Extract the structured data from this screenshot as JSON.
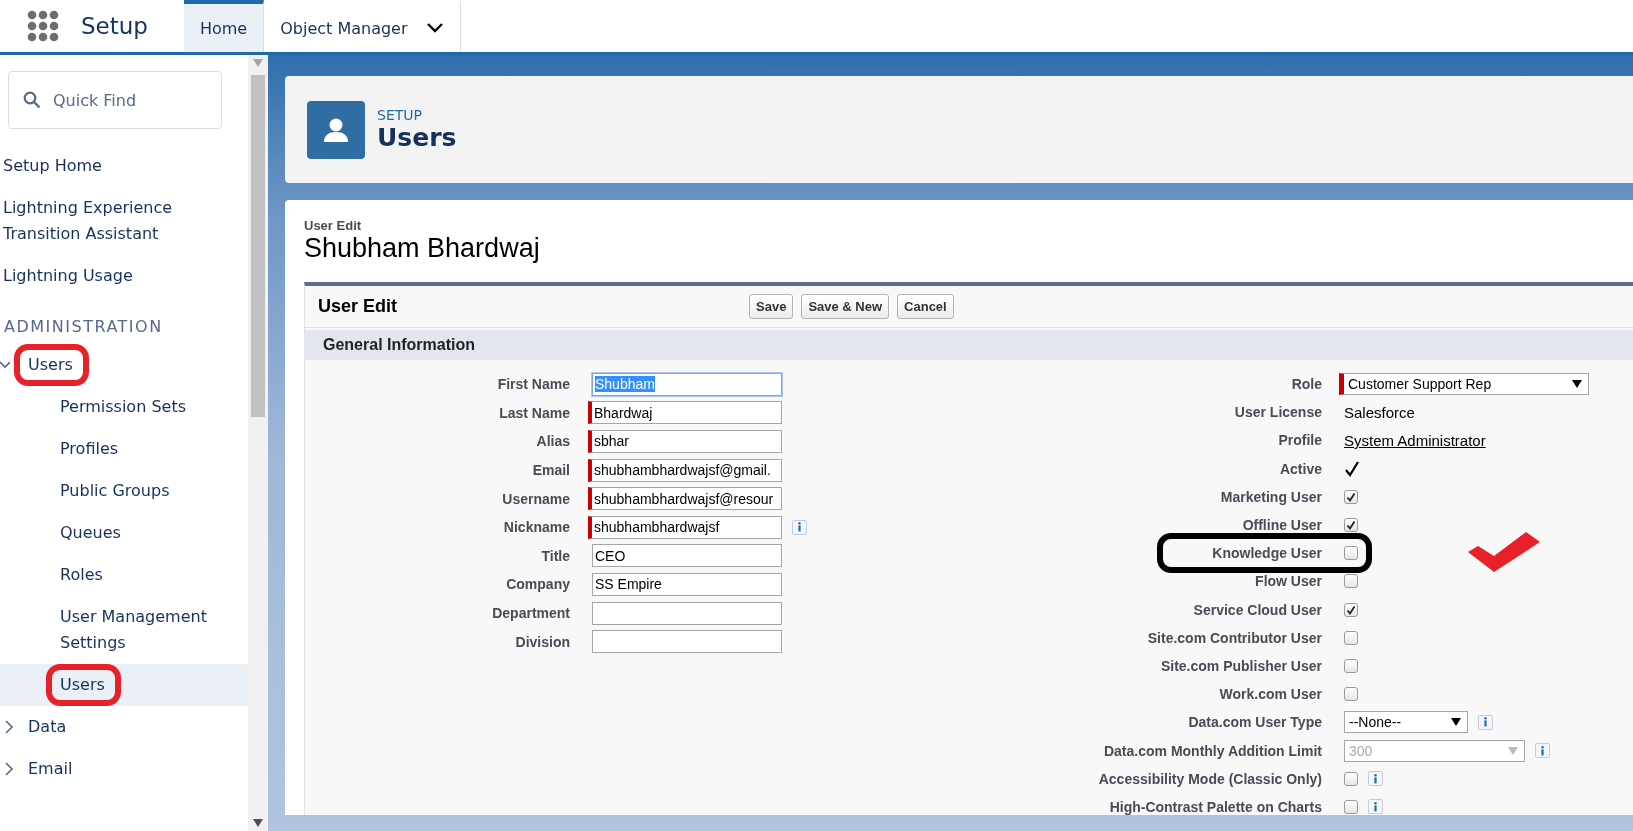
{
  "header": {
    "app": "Setup",
    "tabs": [
      {
        "label": "Home",
        "selected": true,
        "menu": false
      },
      {
        "label": "Object Manager",
        "selected": false,
        "menu": true
      }
    ]
  },
  "sidebar": {
    "search": {
      "placeholder": "Quick Find"
    },
    "items": [
      {
        "label": "Setup Home",
        "selected": false,
        "circled": false
      },
      {
        "label": "Lightning Experience Transition Assistant",
        "selected": false,
        "circled": false
      },
      {
        "label": "Lightning Usage",
        "selected": false,
        "circled": false
      }
    ],
    "heading": "ADMINISTRATION",
    "admin_items": [
      {
        "label": "Users",
        "selected": false,
        "circled": true,
        "expanded": true,
        "children": [
          {
            "label": "Permission Sets",
            "selected": false,
            "circled": false
          },
          {
            "label": "Profiles",
            "selected": false,
            "circled": false
          },
          {
            "label": "Public Groups",
            "selected": false,
            "circled": false
          },
          {
            "label": "Queues",
            "selected": false,
            "circled": false
          },
          {
            "label": "Roles",
            "selected": false,
            "circled": false
          },
          {
            "label": "User Management Settings",
            "selected": false,
            "circled": false
          },
          {
            "label": "Users",
            "selected": true,
            "circled": true
          }
        ]
      },
      {
        "label": "Data",
        "selected": false,
        "circled": false,
        "expanded": false
      },
      {
        "label": "Email",
        "selected": false,
        "circled": false,
        "expanded": false
      }
    ]
  },
  "page_header": {
    "eyebrow": "SETUP",
    "title": "Users"
  },
  "record": {
    "eyebrow": "User Edit",
    "title": "Shubham Bhardwaj"
  },
  "form": {
    "title": "User Edit",
    "buttons": [
      "Save",
      "Save & New",
      "Cancel"
    ],
    "section": "General Information",
    "left_fields": [
      {
        "label": "First Name",
        "value": "Shubham",
        "required": false,
        "highlighted": true
      },
      {
        "label": "Last Name",
        "value": "Bhardwaj",
        "required": true,
        "highlighted": false
      },
      {
        "label": "Alias",
        "value": "sbhar",
        "required": true,
        "highlighted": false
      },
      {
        "label": "Email",
        "value": "shubhambhardwajsf@gmail.",
        "required": true,
        "highlighted": false
      },
      {
        "label": "Username",
        "value": "shubhambhardwajsf@resour",
        "required": true,
        "highlighted": false
      },
      {
        "label": "Nickname",
        "value": "shubhambhardwajsf",
        "required": true,
        "highlighted": false,
        "info": true
      },
      {
        "label": "Title",
        "value": "CEO",
        "required": false,
        "highlighted": false
      },
      {
        "label": "Company",
        "value": "SS Empire",
        "required": false,
        "highlighted": false
      },
      {
        "label": "Department",
        "required": false,
        "highlighted": false
      },
      {
        "label": "Division",
        "required": false,
        "highlighted": false
      }
    ],
    "right_fields": [
      {
        "label": "Role",
        "kind": "select",
        "value": "Customer Support Rep",
        "required": true,
        "disabled": false
      },
      {
        "label": "User License",
        "kind": "text",
        "value": "Salesforce"
      },
      {
        "label": "Profile",
        "kind": "link",
        "value": "System Administrator"
      },
      {
        "label": "Active",
        "kind": "tick",
        "checked": true
      },
      {
        "label": "Marketing User",
        "kind": "checkbox",
        "checked": true
      },
      {
        "label": "Offline User",
        "kind": "checkbox",
        "checked": true
      },
      {
        "label": "Knowledge User",
        "kind": "checkbox",
        "checked": false,
        "circled": true
      },
      {
        "label": "Flow User",
        "kind": "checkbox",
        "checked": false
      },
      {
        "label": "Service Cloud User",
        "kind": "checkbox",
        "checked": true
      },
      {
        "label": "Site.com Contributor User",
        "kind": "checkbox",
        "checked": false
      },
      {
        "label": "Site.com Publisher User",
        "kind": "checkbox",
        "checked": false
      },
      {
        "label": "Work.com User",
        "kind": "checkbox",
        "checked": false
      },
      {
        "label": "Data.com User Type",
        "kind": "select",
        "value": "--None--",
        "required": false,
        "disabled": false,
        "info": true
      },
      {
        "label": "Data.com Monthly Addition Limit",
        "kind": "select",
        "value": "300",
        "required": false,
        "disabled": true,
        "info": true
      },
      {
        "label": "Accessibility Mode (Classic Only)",
        "kind": "checkbox",
        "checked": false,
        "info": true
      },
      {
        "label": "High-Contrast Palette on Charts",
        "kind": "checkbox",
        "checked": false,
        "info": true
      }
    ]
  }
}
